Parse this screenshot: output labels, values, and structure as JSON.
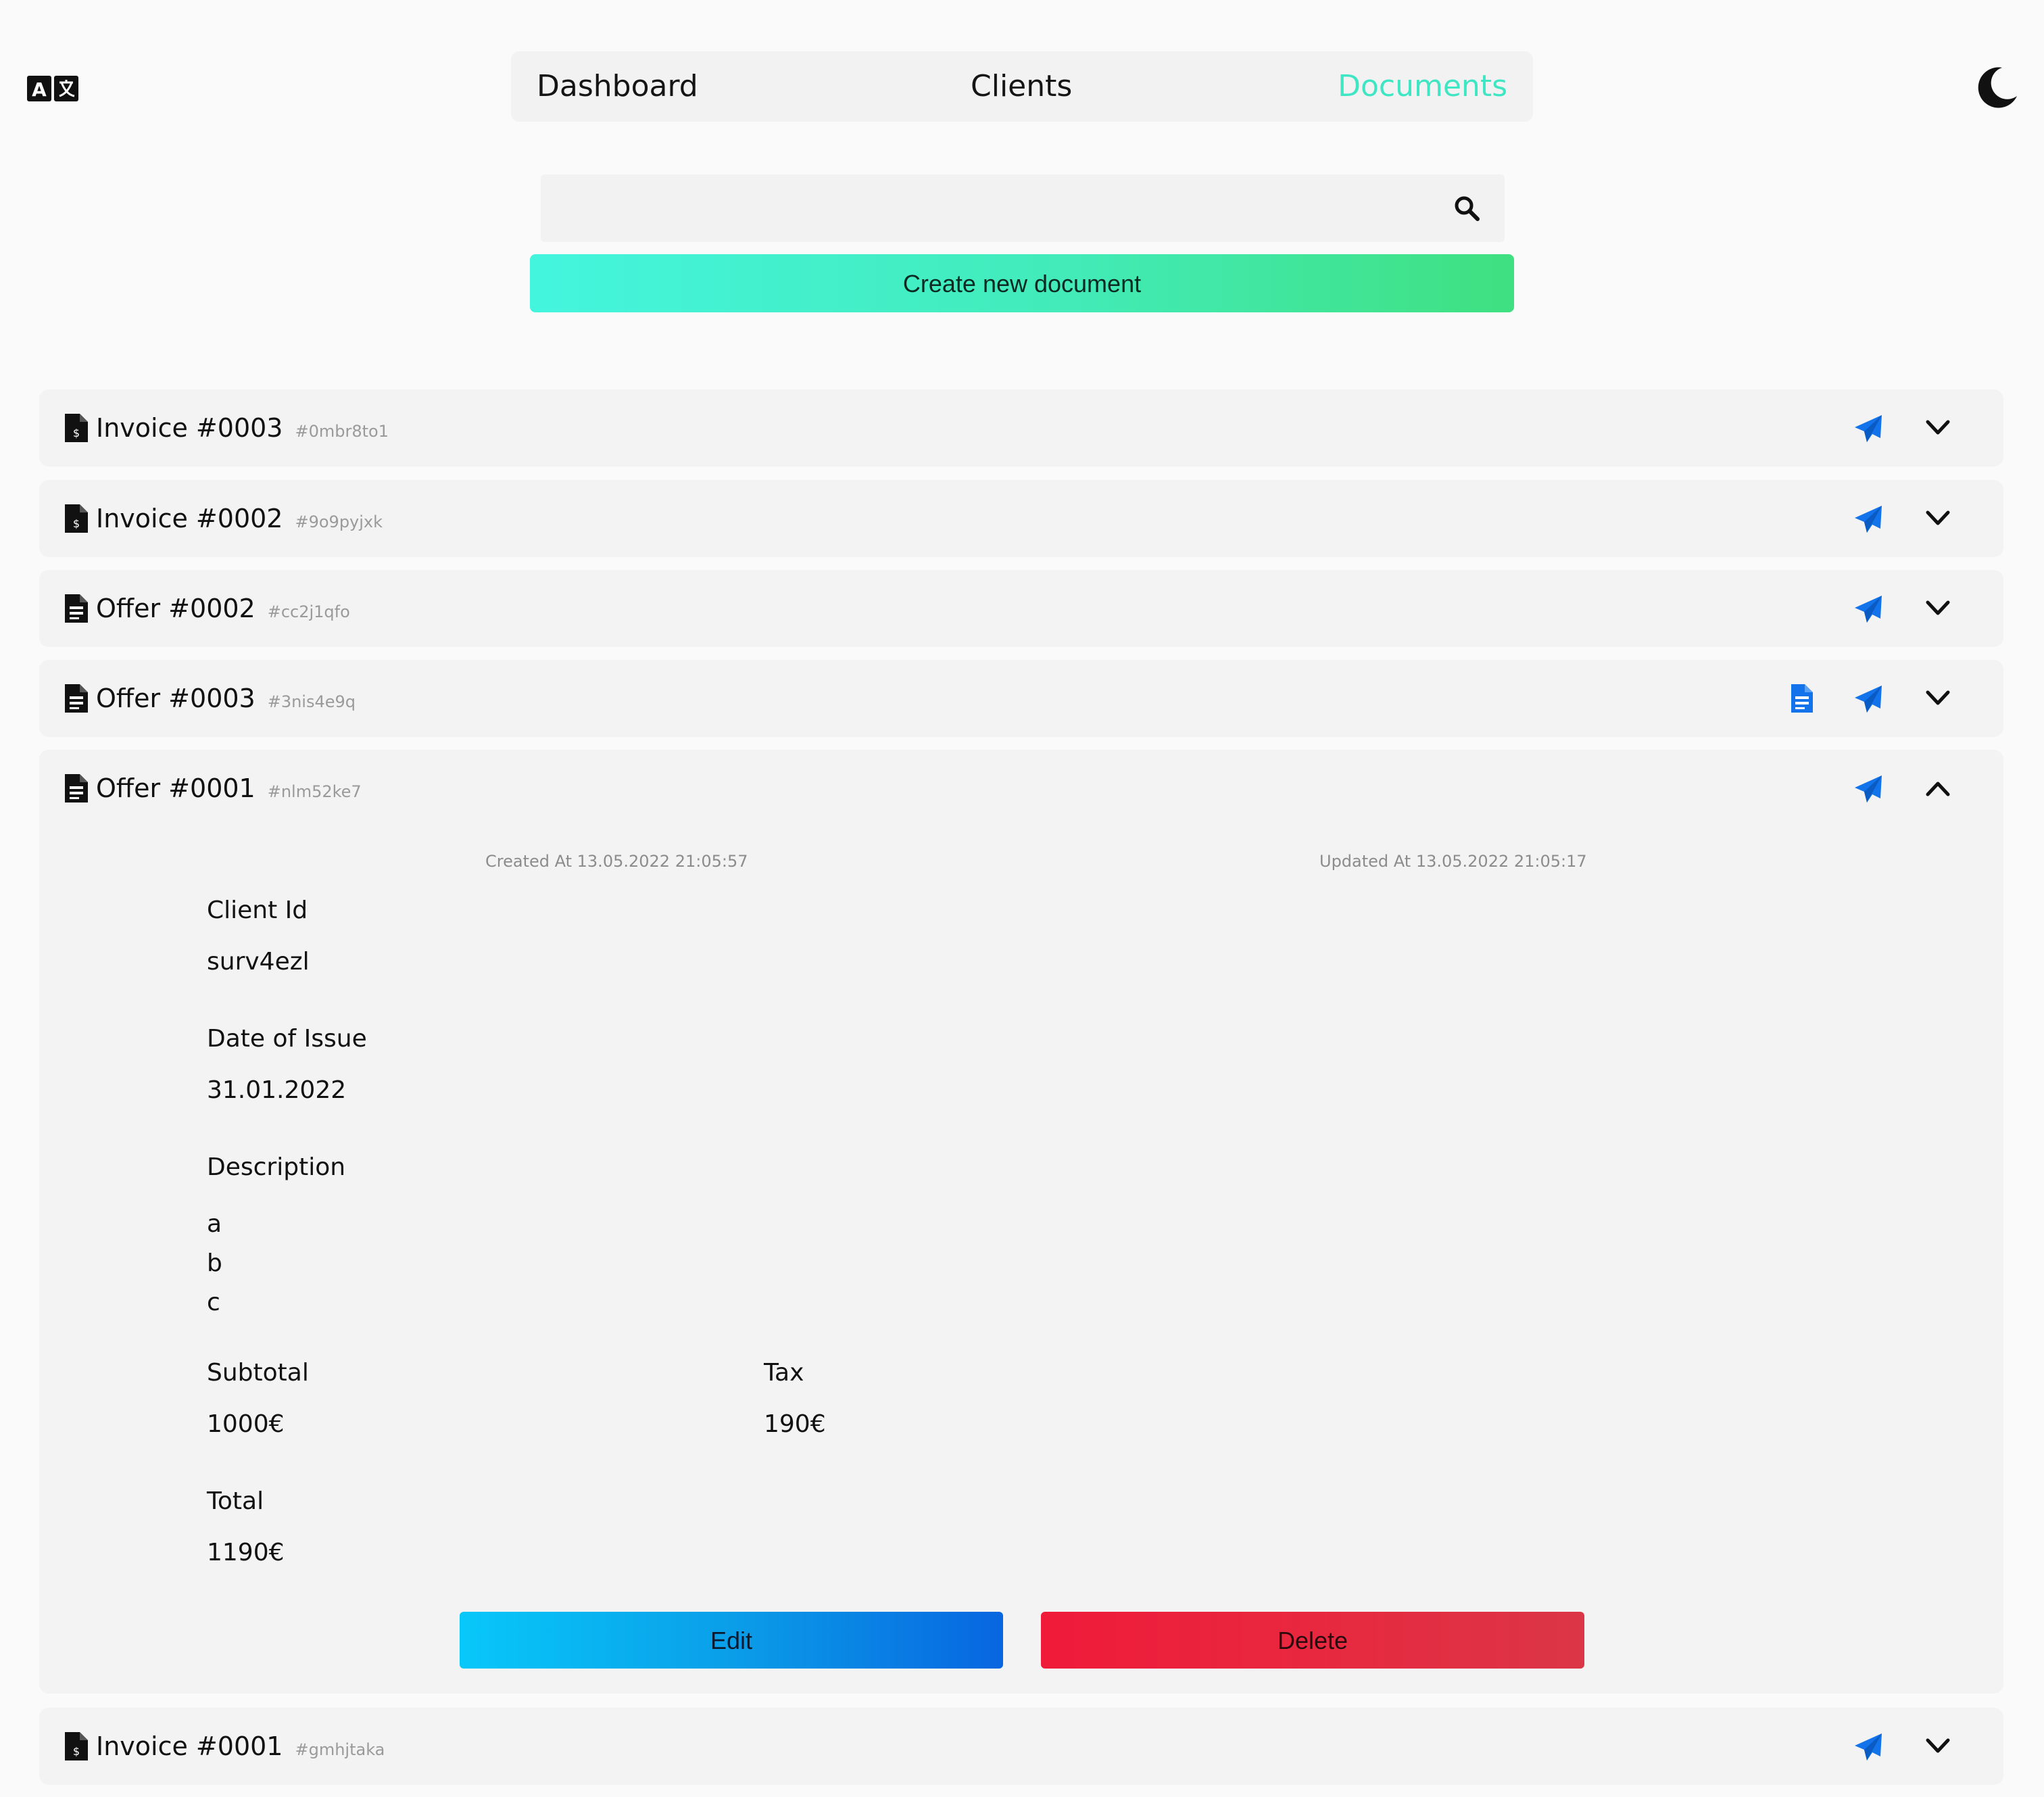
{
  "nav": {
    "items": [
      {
        "label": "Dashboard"
      },
      {
        "label": "Clients"
      },
      {
        "label": "Documents"
      }
    ],
    "active_color": "#3fe6c4"
  },
  "search": {
    "placeholder": "",
    "value": ""
  },
  "create_button": {
    "label": "Create new document"
  },
  "documents": [
    {
      "type": "invoice",
      "title": "Invoice #0003",
      "id": "#0mbr8to1",
      "expanded": false
    },
    {
      "type": "invoice",
      "title": "Invoice #0002",
      "id": "#9o9pyjxk",
      "expanded": false
    },
    {
      "type": "offer",
      "title": "Offer #0002",
      "id": "#cc2j1qfo",
      "expanded": false
    },
    {
      "type": "offer",
      "title": "Offer #0003",
      "id": "#3nis4e9q",
      "expanded": false,
      "has_pdf": true
    },
    {
      "type": "offer",
      "title": "Offer #0001",
      "id": "#nlm52ke7",
      "expanded": true
    },
    {
      "type": "invoice",
      "title": "Invoice #0001",
      "id": "#gmhjtaka",
      "expanded": false
    }
  ],
  "details": {
    "created_at": "Created At 13.05.2022 21:05:57",
    "updated_at": "Updated At 13.05.2022 21:05:17",
    "client_id_label": "Client Id",
    "client_id": "surv4ezl",
    "date_label": "Date of Issue",
    "date": "31.01.2022",
    "description_label": "Description",
    "description_lines": [
      "a",
      "b",
      "c"
    ],
    "subtotal_label": "Subtotal",
    "subtotal": "1000€",
    "tax_label": "Tax",
    "tax": "190€",
    "total_label": "Total",
    "total": "1190€",
    "edit_label": "Edit",
    "delete_label": "Delete"
  },
  "icons": {
    "language": "language-icon",
    "theme": "moon-icon",
    "search": "search-icon",
    "send": "send-icon",
    "expand": "chevron-down-icon",
    "collapse": "chevron-up-icon",
    "pdf": "pdf-document-icon",
    "invoice": "invoice-file-icon",
    "offer": "offer-file-icon"
  },
  "colors": {
    "accent_blue": "#1273eb",
    "background": "#fafafa",
    "row_background": "#f3f3f3"
  }
}
